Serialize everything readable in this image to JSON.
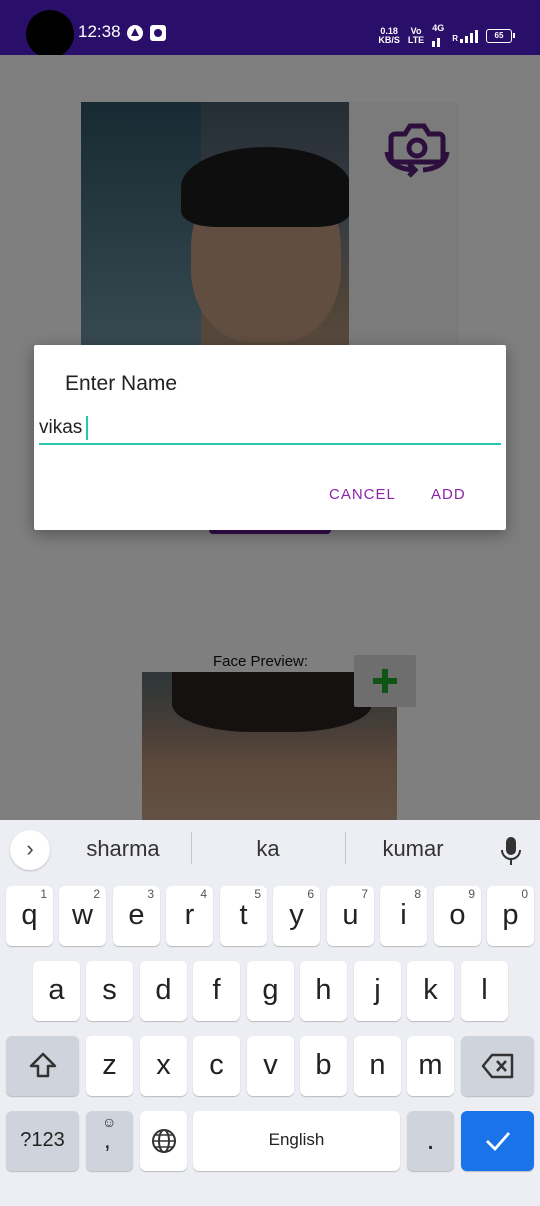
{
  "status_bar": {
    "time": "12:38",
    "network_speed": "0.18",
    "network_unit": "KB/S",
    "volte_top": "Vo",
    "volte_bottom": "LTE",
    "network_type": "4G",
    "signal_label": "R",
    "battery": "65"
  },
  "dialog": {
    "title": "Enter Name",
    "input_value": "vikas",
    "cancel_label": "CANCEL",
    "add_label": "ADD"
  },
  "app": {
    "face_preview_label": "Face Preview:"
  },
  "keyboard": {
    "suggestions": [
      "sharma",
      "ka",
      "kumar"
    ],
    "row1": [
      {
        "key": "q",
        "hint": "1"
      },
      {
        "key": "w",
        "hint": "2"
      },
      {
        "key": "e",
        "hint": "3"
      },
      {
        "key": "r",
        "hint": "4"
      },
      {
        "key": "t",
        "hint": "5"
      },
      {
        "key": "y",
        "hint": "6"
      },
      {
        "key": "u",
        "hint": "7"
      },
      {
        "key": "i",
        "hint": "8"
      },
      {
        "key": "o",
        "hint": "9"
      },
      {
        "key": "p",
        "hint": "0"
      }
    ],
    "row2": [
      "a",
      "s",
      "d",
      "f",
      "g",
      "h",
      "j",
      "k",
      "l"
    ],
    "row3": [
      "z",
      "x",
      "c",
      "v",
      "b",
      "n",
      "m"
    ],
    "symbols_label": "?123",
    "comma_label": ",",
    "space_label": "English",
    "period_label": "."
  },
  "colors": {
    "status_bar": "#2a0f6a",
    "accent_purple": "#8e24aa",
    "input_underline": "#26c6b3",
    "enter_key": "#1a73e8"
  }
}
